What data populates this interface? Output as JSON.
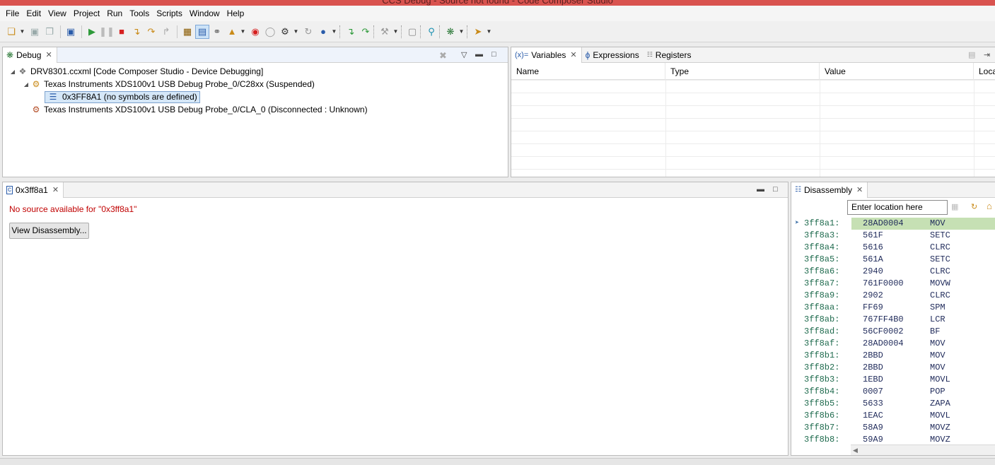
{
  "window": {
    "title": "CCS Debug - Source not found - Code Composer Studio"
  },
  "menu": [
    "File",
    "Edit",
    "View",
    "Project",
    "Run",
    "Tools",
    "Scripts",
    "Window",
    "Help"
  ],
  "debug_view": {
    "tab_label": "Debug",
    "tree": [
      {
        "level": 0,
        "label": "DRV8301.ccxml [Code Composer Studio - Device Debugging]",
        "icon": "config-icon",
        "expanded": true
      },
      {
        "level": 1,
        "label": "Texas Instruments XDS100v1 USB Debug Probe_0/C28xx (Suspended)",
        "icon": "cpu-suspended-icon",
        "expanded": true
      },
      {
        "level": 2,
        "label": "0x3FF8A1  (no symbols are defined)",
        "icon": "stack-frame-icon",
        "selected": true
      },
      {
        "level": 1,
        "label": "Texas Instruments XDS100v1 USB Debug Probe_0/CLA_0 (Disconnected : Unknown)",
        "icon": "cpu-disconnected-icon"
      }
    ]
  },
  "variables_view": {
    "tabs": [
      {
        "label": "Variables",
        "prefix": "(x)="
      },
      {
        "label": "Expressions"
      },
      {
        "label": "Registers"
      }
    ],
    "columns": [
      "Name",
      "Type",
      "Value",
      "Loca"
    ]
  },
  "editor": {
    "tab_label": "0x3ff8a1",
    "message": "No source available for \"0x3ff8a1\"",
    "button": "View Disassembly..."
  },
  "disassembly": {
    "tab_label": "Disassembly",
    "location_placeholder": "Enter location here",
    "rows": [
      {
        "addr": "3ff8a1:",
        "opcode": "28AD0004",
        "mnemonic": "MOV"
      },
      {
        "addr": "3ff8a3:",
        "opcode": "561F",
        "mnemonic": "SETC"
      },
      {
        "addr": "3ff8a4:",
        "opcode": "5616",
        "mnemonic": "CLRC"
      },
      {
        "addr": "3ff8a5:",
        "opcode": "561A",
        "mnemonic": "SETC"
      },
      {
        "addr": "3ff8a6:",
        "opcode": "2940",
        "mnemonic": "CLRC"
      },
      {
        "addr": "3ff8a7:",
        "opcode": "761F0000",
        "mnemonic": "MOVW"
      },
      {
        "addr": "3ff8a9:",
        "opcode": "2902",
        "mnemonic": "CLRC"
      },
      {
        "addr": "3ff8aa:",
        "opcode": "FF69",
        "mnemonic": "SPM"
      },
      {
        "addr": "3ff8ab:",
        "opcode": "767FF4B0",
        "mnemonic": "LCR"
      },
      {
        "addr": "3ff8ad:",
        "opcode": "56CF0002",
        "mnemonic": "BF"
      },
      {
        "addr": "3ff8af:",
        "opcode": "28AD0004",
        "mnemonic": "MOV"
      },
      {
        "addr": "3ff8b1:",
        "opcode": "2BBD",
        "mnemonic": "MOV"
      },
      {
        "addr": "3ff8b2:",
        "opcode": "2BBD",
        "mnemonic": "MOV"
      },
      {
        "addr": "3ff8b3:",
        "opcode": "1EBD",
        "mnemonic": "MOVL"
      },
      {
        "addr": "3ff8b4:",
        "opcode": "0007",
        "mnemonic": "POP"
      },
      {
        "addr": "3ff8b5:",
        "opcode": "5633",
        "mnemonic": "ZAPA"
      },
      {
        "addr": "3ff8b6:",
        "opcode": "1EAC",
        "mnemonic": "MOVL"
      },
      {
        "addr": "3ff8b7:",
        "opcode": "58A9",
        "mnemonic": "MOVZ"
      },
      {
        "addr": "3ff8b8:",
        "opcode": "59A9",
        "mnemonic": "MOVZ"
      }
    ]
  },
  "colors": {
    "error_text": "#c00000",
    "current_line": "#c6e0b4",
    "title_bar": "#d9534f"
  }
}
